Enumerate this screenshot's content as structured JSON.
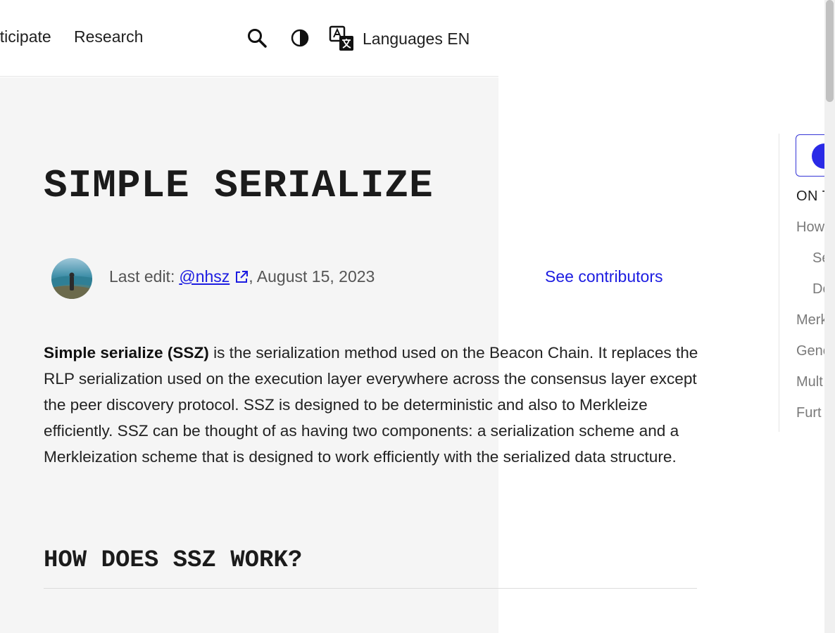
{
  "header": {
    "nav": [
      "Participate",
      "Research"
    ],
    "languages_label": "Languages EN"
  },
  "article": {
    "title": "SIMPLE SERIALIZE",
    "last_edit_prefix": "Last edit:",
    "editor": "@nhsz",
    "edit_date": ", August 15, 2023",
    "see_contributors": "See contributors",
    "intro_bold": "Simple serialize (SSZ)",
    "intro_rest": " is the serialization method used on the Beacon Chain. It replaces the RLP serialization used on the execution layer everywhere across the consensus layer except the peer discovery protocol. SSZ is designed to be deterministic and also to Merkleize efficiently. SSZ can be thought of as having two components: a serialization scheme and a Merkleization scheme that is designed to work efficiently with the serialized data structure.",
    "section_heading": "HOW DOES SSZ WORK?"
  },
  "toc": {
    "heading": "ON T",
    "items": [
      "How",
      "Se",
      "De",
      "Merk",
      "Gene",
      "Mult",
      "Furt"
    ]
  },
  "colors": {
    "link": "#1c1ce1",
    "panel_bg": "#f5f5f5"
  },
  "icons": [
    "search-icon",
    "moon-icon",
    "translate-icon",
    "external-link-icon",
    "github-icon"
  ]
}
